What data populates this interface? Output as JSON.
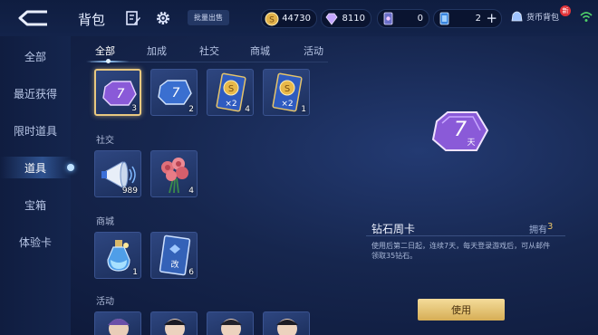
{
  "header": {
    "title": "背包",
    "batch_sell_label": "批量出售",
    "coins": "44730",
    "diamonds": "8110",
    "tickets_a": "0",
    "tickets_b": "2",
    "currency_bag_label": "货币背包",
    "new_badge": "新"
  },
  "sidebar": {
    "items": [
      {
        "label": "全部"
      },
      {
        "label": "最近获得"
      },
      {
        "label": "限时道具"
      },
      {
        "label": "道具"
      },
      {
        "label": "宝箱"
      },
      {
        "label": "体验卡"
      }
    ],
    "active_index": 3
  },
  "tabs": [
    {
      "label": "全部"
    },
    {
      "label": "加成"
    },
    {
      "label": "社交"
    },
    {
      "label": "商城"
    },
    {
      "label": "活动"
    }
  ],
  "sections": {
    "social": "社交",
    "mall": "商城",
    "activity": "活动"
  },
  "items": {
    "row1": [
      {
        "icon": "purple-7day-card-icon",
        "count": "3"
      },
      {
        "icon": "blue-7day-card-icon",
        "count": "2"
      },
      {
        "icon": "double-coin-card-icon",
        "count": "4",
        "badge": "×2"
      },
      {
        "icon": "double-coin-card-icon",
        "count": "1",
        "badge": "×2"
      }
    ],
    "social": [
      {
        "icon": "megaphone-icon",
        "count": "989"
      },
      {
        "icon": "rose-bouquet-icon",
        "count": "4"
      }
    ],
    "mall": [
      {
        "icon": "potion-bottle-icon",
        "count": "1"
      },
      {
        "icon": "rename-card-icon",
        "count": "6",
        "badge": "改"
      }
    ]
  },
  "detail": {
    "name": "钻石周卡",
    "own_label": "拥有",
    "own_count": "3",
    "description": "使用后第二日起，连续7天，每天登录游戏后，可从邮件领取35钻石。",
    "use_button": "使用",
    "card_text": "7",
    "card_sub": "天"
  },
  "colors": {
    "accent_gold": "#e8c368",
    "selection_border": "#e8c880",
    "button_gold": "#d6ad55"
  }
}
